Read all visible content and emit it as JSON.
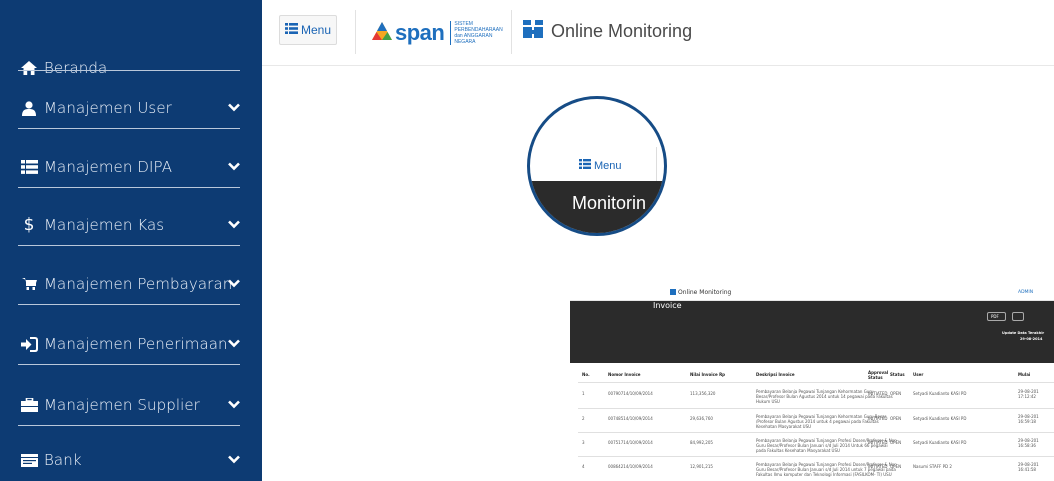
{
  "sidebar": {
    "items": [
      {
        "label": "Beranda",
        "icon": "home-icon",
        "chevron": false
      },
      {
        "label": "Manajemen User",
        "icon": "user-icon",
        "chevron": true
      },
      {
        "label": "Manajemen DIPA",
        "icon": "list-icon",
        "chevron": true
      },
      {
        "label": "Manajemen Kas",
        "icon": "dollar-icon",
        "chevron": true
      },
      {
        "label": "Manajemen Pembayaran",
        "icon": "cart-icon",
        "chevron": true
      },
      {
        "label": "Manajemen Penerimaan",
        "icon": "sign-in-icon",
        "chevron": true
      },
      {
        "label": "Manajemen Supplier",
        "icon": "briefcase-icon",
        "chevron": true
      },
      {
        "label": "Bank",
        "icon": "bank-icon",
        "chevron": true
      }
    ]
  },
  "topbar": {
    "menu_label": "Menu",
    "logo_word": "span",
    "logo_sub_1": "SISTEM PERBENDAHARAAN",
    "logo_sub_2": "dan ANGGARAN NEGARA",
    "title": "Online Monitoring"
  },
  "inner": {
    "menu_label": "Menu",
    "title_circle": "Monitorin",
    "title_rest": "Invoice",
    "small_title": "Online Monitoring",
    "admin": "ADMIN",
    "pdf": "PDF",
    "update_label": "Update Data Terakhir",
    "update_date": "29-08-2014",
    "headers": [
      "No.",
      "Nomor Invoice",
      "Nilai Invoice Rp",
      "Deskripsi Invoice",
      "Approval Status",
      "Status",
      "User",
      "Mulai"
    ],
    "rows": [
      {
        "no": "1",
        "nomor": "00790714/10/09/2014",
        "nilai": "113,356,320",
        "desc1": "Pembayaran Belanja Pegawai Tunjangan Kehormatan Guru",
        "desc2": "Besar/Profesor Bulan Agustus 2014 untuk 14 pegawai pada Fakultas",
        "desc3": "Hukum USU",
        "approval": "INITIATED",
        "status": "OPEN",
        "user": "Setyadi Kuadianto KASI PD",
        "mulai": "29-08-201",
        "mulai2": "17:12:42"
      },
      {
        "no": "2",
        "nomor": "00748514/10/09/2014",
        "nilai": "29,636,760",
        "desc1": "Pembayaran Belanja Pegawai Tunjangan Kehormatan Guru Besar",
        "desc2": "/Profesor Bulan Agustus 2014 untuk 4 pegawai pada Fakultas",
        "desc3": "Kesehatan Masyarakat USU",
        "approval": "INITIATED",
        "status": "OPEN",
        "user": "Setyadi Kuadianto KASI PD",
        "mulai": "29-08-201",
        "mulai2": "16:59:18"
      },
      {
        "no": "3",
        "nomor": "00751714/10/09/2014",
        "nilai": "84,992,205",
        "desc1": "Pembayaran Belanja Pegawai Tunjangan Profesi Dosen/Profesor & Non",
        "desc2": "Guru Besar/Profesor Bulan Januari s/d Juli 2014 Untuk 66 pegawai",
        "desc3": "pada Fakultas Kesehatan Masyarakat USU",
        "approval": "INITIATED",
        "status": "OPEN",
        "user": "Setyadi Kuadianto KASI PD",
        "mulai": "29-08-201",
        "mulai2": "16:58:36"
      },
      {
        "no": "4",
        "nomor": "00864214/10/09/2014",
        "nilai": "12,901,215",
        "desc1": "Pembayaran Belanja Pegawai Tunjangan Profesi Dosen/Profesor & Non",
        "desc2": "Guru Besar/Profesor Bulan Januari s/d Juli 2014 untuk 7 pegawai pada",
        "desc3": "Fakultas Ilmu komputer dan Teknologi Informasi (FASILKOM- TI) USU",
        "approval": "INITIATED",
        "status": "OPEN",
        "user": "Nasumi STAFF PD 2",
        "mulai": "29-08-201",
        "mulai2": "16:41:58"
      }
    ]
  },
  "colors": {
    "sidebar_bg": "#0d3b73",
    "accent": "#1e6fbe",
    "dark_header": "#2b2b2b"
  }
}
